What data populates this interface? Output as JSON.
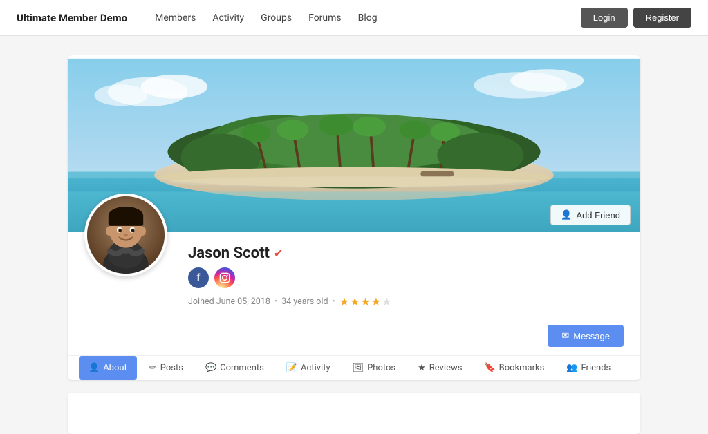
{
  "nav": {
    "brand": "Ultimate Member Demo",
    "links": [
      "Members",
      "Activity",
      "Groups",
      "Forums",
      "Blog"
    ],
    "login_label": "Login",
    "register_label": "Register"
  },
  "profile": {
    "name": "Jason Scott",
    "verified": true,
    "joined": "Joined June 05, 2018",
    "age": "34 years old",
    "stars_filled": 3,
    "stars_half": 1,
    "stars_empty": 1,
    "add_friend_label": "Add Friend",
    "message_label": "Message",
    "social": {
      "facebook": "f",
      "instagram": "♥"
    }
  },
  "tabs": [
    {
      "id": "about",
      "label": "About",
      "icon": "person",
      "active": true
    },
    {
      "id": "posts",
      "label": "Posts",
      "icon": "pencil",
      "active": false
    },
    {
      "id": "comments",
      "label": "Comments",
      "icon": "bubble",
      "active": false
    },
    {
      "id": "activity",
      "label": "Activity",
      "icon": "edit",
      "active": false
    },
    {
      "id": "photos",
      "label": "Photos",
      "icon": "photo",
      "active": false
    },
    {
      "id": "reviews",
      "label": "Reviews",
      "icon": "star",
      "active": false
    },
    {
      "id": "bookmarks",
      "label": "Bookmarks",
      "icon": "bookmark",
      "active": false
    },
    {
      "id": "friends",
      "label": "Friends",
      "icon": "people",
      "active": false
    }
  ]
}
